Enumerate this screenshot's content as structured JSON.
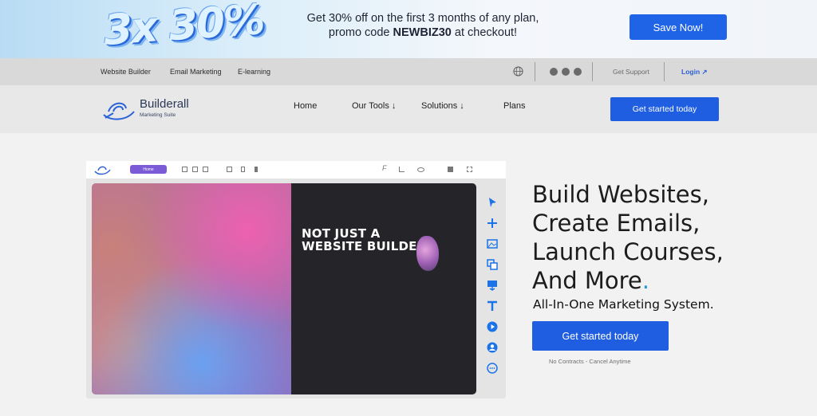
{
  "promo": {
    "art_text": "3x 30%",
    "line1": "Get 30% off on the first 3 months of any plan,",
    "line2_prefix": "promo code ",
    "code": "NEWBIZ30",
    "line2_suffix": " at checkout!",
    "button": "Save Now!"
  },
  "topbar": {
    "links": [
      "Website Builder",
      "Email Marketing",
      "E-learning"
    ],
    "support": "Get Support",
    "login": "Login ↗"
  },
  "nav": {
    "brand": "Builderall",
    "brand_sub": "Marketing Suite",
    "items": [
      "Home",
      "Our Tools ↓",
      "Solutions ↓",
      "Plans"
    ],
    "cta": "Get started today"
  },
  "editor": {
    "pill_label": "Home",
    "canvas_text_line1": "NOT JUST A",
    "canvas_text_line2": "WEBSITE BUILDER"
  },
  "hero": {
    "headline": [
      "Build Websites,",
      "Create Emails,",
      "Launch Courses,",
      "And More"
    ],
    "headline_dot": ".",
    "subhead": "All-In-One Marketing System.",
    "cta": "Get started today",
    "note": "No Contracts - Cancel Anytime"
  },
  "colors": {
    "accent": "#1f5ee0",
    "dot": "#1e9bd7",
    "tool_icon": "#1a73e8"
  },
  "icons": [
    "globe-icon",
    "youtube-icon",
    "facebook-icon",
    "instagram-icon",
    "cursor-icon",
    "plus-icon",
    "image-icon",
    "copy-icon",
    "download-icon",
    "text-icon",
    "play-icon",
    "user-icon",
    "chat-icon"
  ]
}
